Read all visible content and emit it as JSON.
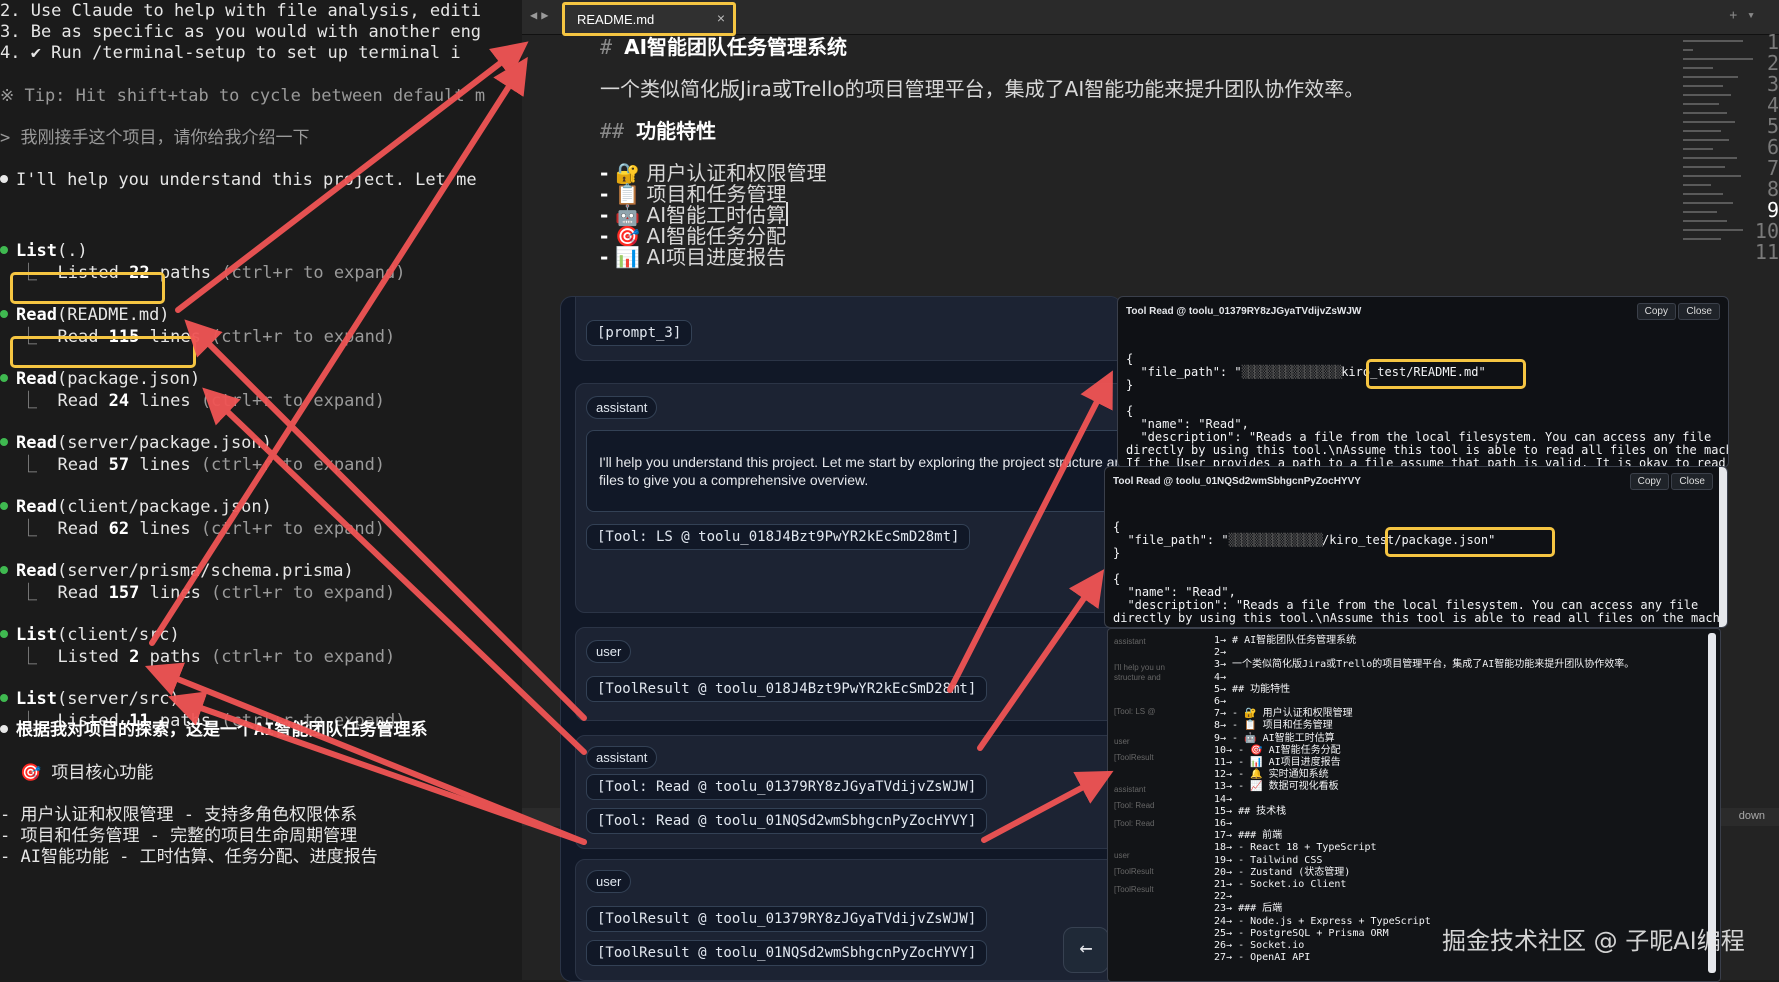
{
  "terminal": {
    "lines": [
      "2. Use Claude to help with file analysis, editi",
      "3. Be as specific as you would with another eng",
      "4. ✔ Run /terminal-setup to set up terminal i",
      "※ Tip: Hit shift+tab to cycle between default m",
      "> 我刚接手这个项目，请你给我介绍一下",
      "I'll help you understand this project. Let me"
    ],
    "tools": [
      {
        "call_name": "List",
        "call_arg": "(.)",
        "result_pre": "Listed ",
        "result_num": "22",
        "result_post": " paths",
        "hint": " (ctrl+r to expand)"
      },
      {
        "call_name": "Read",
        "call_arg": "(README.md)",
        "result_pre": "Read ",
        "result_num": "115",
        "result_post": " lines",
        "hint": " (ctrl+r to expand)"
      },
      {
        "call_name": "Read",
        "call_arg": "(package.json)",
        "result_pre": "Read ",
        "result_num": "24",
        "result_post": " lines",
        "hint": " (ctrl+r to expand)"
      },
      {
        "call_name": "Read",
        "call_arg": "(server/package.json)",
        "result_pre": "Read ",
        "result_num": "57",
        "result_post": " lines",
        "hint": " (ctrl+r to expand)"
      },
      {
        "call_name": "Read",
        "call_arg": "(client/package.json)",
        "result_pre": "Read ",
        "result_num": "62",
        "result_post": " lines",
        "hint": " (ctrl+r to expand)"
      },
      {
        "call_name": "Read",
        "call_arg": "(server/prisma/schema.prisma)",
        "result_pre": "Read ",
        "result_num": "157",
        "result_post": " lines",
        "hint": " (ctrl+r to expand)"
      },
      {
        "call_name": "List",
        "call_arg": "(client/src)",
        "result_pre": "Listed ",
        "result_num": "2",
        "result_post": " paths",
        "hint": " (ctrl+r to expand)"
      },
      {
        "call_name": "List",
        "call_arg": "(server/src)",
        "result_pre": "Listed ",
        "result_num": "11",
        "result_post": " paths",
        "hint": " (ctrl+r to expand)"
      }
    ],
    "summary": "根据我对项目的探索，这是一个AI智能团队任务管理系",
    "section_title": "🎯 项目核心功能",
    "bullets": [
      "- 用户认证和权限管理 - 支持多角色权限体系",
      "- 项目和任务管理 - 完整的项目生命周期管理",
      "- AI智能功能 - 工时估算、任务分配、进度报告"
    ]
  },
  "editor": {
    "tab_name": "README.md",
    "lines": [
      {
        "num": "1",
        "text": "AI智能团队任务管理系统",
        "prefix": "# "
      },
      {
        "num": "2",
        "text": "",
        "prefix": ""
      },
      {
        "num": "3",
        "text": "一个类似简化版Jira或Trello的项目管理平台，集成了AI智能功能来提升团队协作效率。",
        "prefix": ""
      },
      {
        "num": "4",
        "text": "",
        "prefix": ""
      },
      {
        "num": "5",
        "text": "功能特性",
        "prefix": "## "
      },
      {
        "num": "6",
        "text": "",
        "prefix": ""
      },
      {
        "num": "7",
        "text": "🔐 用户认证和权限管理",
        "prefix": "- "
      },
      {
        "num": "8",
        "text": "📋 项目和任务管理",
        "prefix": "- "
      },
      {
        "num": "9",
        "text": "🤖 AI智能工时估算",
        "prefix": "- "
      },
      {
        "num": "10",
        "text": "🎯 AI智能任务分配",
        "prefix": "- "
      },
      {
        "num": "11",
        "text": "📊 AI项目进度报告",
        "prefix": "- "
      }
    ],
    "status_right": "down"
  },
  "chat": {
    "prompt_pill": "[prompt_3]",
    "assistant_label": "assistant",
    "user_label": "user",
    "assistant_text": "I'll help you understand this project. Let me start by exploring the project structure and key files to give you a comprehensive overview.",
    "tool_ls": "[Tool: LS @ toolu_018J4Bzt9PwYR2kEcSmD28mt]",
    "result_ls": "[ToolResult @ toolu_018J4Bzt9PwYR2kEcSmD28mt]",
    "tool_read1": "[Tool: Read @ toolu_01379RY8zJGyaTVdijvZsWJW]",
    "tool_read2": "[Tool: Read @ toolu_01NQSd2wmSbhgcnPyZocHYVY]",
    "result_read1": "[ToolResult @ toolu_01379RY8zJGyaTVdijvZsWJW]",
    "result_read2": "[ToolResult @ toolu_01NQSd2wmSbhgcnPyZocHYVY]",
    "back_icon": "←"
  },
  "tool_panel_1": {
    "title": "Tool Read @ toolu_01379RY8zJGyaTVdijvZsWJW",
    "copy": "Copy",
    "close": "Close",
    "path_key": "  \"file_path\": \"",
    "path_tail": "kiro_test/README.md\"",
    "name_line": "  \"name\": \"Read\",",
    "desc_line": "  \"description\": \"Reads a file from the local filesystem. You can access any file",
    "desc_line2": "directly by using this tool.\\nAssume this tool is able to read all files on the machine.",
    "desc_line3": "If the User provides a path to a file assume that path is valid. It is okay to read a"
  },
  "tool_panel_2": {
    "title": "Tool Read @ toolu_01NQSd2wmSbhgcnPyZocHYVY",
    "copy": "Copy",
    "close": "Close",
    "path_key": "  \"file_path\": \"",
    "path_tail": "/kiro_test/package.json\"",
    "name_line": "  \"name\": \"Read\",",
    "desc_line": "  \"description\": \"Reads a file from the local filesystem. You can access any file",
    "desc_line2": "directly by using this tool.\\nAssume this tool is able to read all files on the machine."
  },
  "file_panel": {
    "lines": [
      "1→ # AI智能团队任务管理系统",
      "2→",
      "3→ 一个类似简化版Jira或Trello的项目管理平台，集成了AI智能功能来提升团队协作效率。",
      "4→",
      "5→ ## 功能特性",
      "6→",
      "7→ - 🔐 用户认证和权限管理",
      "8→ - 📋 项目和任务管理",
      "9→ - 🤖 AI智能工时估算",
      "10→ - 🎯 AI智能任务分配",
      "11→ - 📊 AI项目进度报告",
      "12→ - 🔔 实时通知系统",
      "13→ - 📈 数据可视化看板",
      "14→",
      "15→ ## 技术栈",
      "16→",
      "17→ ### 前端",
      "18→ - React 18 + TypeScript",
      "19→ - Tailwind CSS",
      "20→ - Zustand (状态管理)",
      "21→ - Socket.io Client",
      "22→",
      "23→ ### 后端",
      "24→ - Node.js + Express + TypeScript",
      "25→ - PostgreSQL + Prisma ORM",
      "26→ - Socket.io",
      "27→ - OpenAI API"
    ],
    "ghost": [
      "assistant",
      "I'll help you un",
      "structure and",
      "[Tool: LS @",
      "user",
      "[ToolResult",
      "assistant",
      "[Tool: Read",
      "[Tool: Read",
      "user",
      "[ToolResult",
      "[ToolResult"
    ]
  },
  "watermark": "掘金技术社区 @ 子昵AI编程",
  "colors": {
    "highlight": "#f5c542",
    "arrow": "#f05454",
    "chat_bg": "#111827"
  }
}
